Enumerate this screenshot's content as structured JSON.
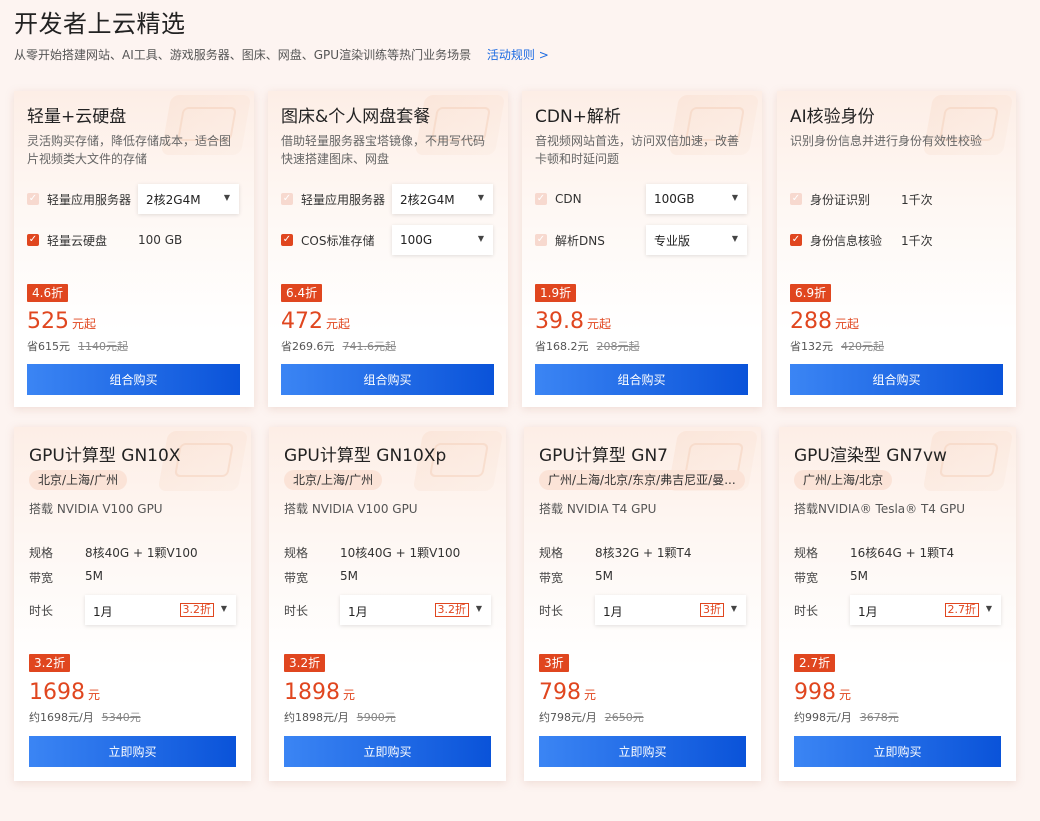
{
  "header": {
    "title": "开发者上云精选",
    "subtitle": "从零开始搭建网站、AI工具、游戏服务器、图床、网盘、GPU渲染训练等热门业务场景",
    "rule_link": "活动规则 >"
  },
  "bundles": [
    {
      "title": "轻量+云硬盘",
      "desc": "灵活购买存储，降低存储成本，适合图片视频类大文件的存储",
      "options": [
        {
          "label": "轻量应用服务器",
          "checked": false,
          "select": "2核2G4M"
        },
        {
          "label": "轻量云硬盘",
          "checked": true,
          "value": "100 GB"
        }
      ],
      "discount": "4.6折",
      "price": "525",
      "price_unit": "元起",
      "save": "省615元",
      "original": "1140元起",
      "buy_label": "组合购买"
    },
    {
      "title": "图床&个人网盘套餐",
      "desc": "借助轻量服务器宝塔镜像，不用写代码快速搭建图床、网盘",
      "options": [
        {
          "label": "轻量应用服务器",
          "checked": false,
          "select": "2核2G4M"
        },
        {
          "label": "COS标准存储",
          "checked": true,
          "select": "100G"
        }
      ],
      "discount": "6.4折",
      "price": "472",
      "price_unit": "元起",
      "save": "省269.6元",
      "original": "741.6元起",
      "buy_label": "组合购买"
    },
    {
      "title": "CDN+解析",
      "desc": "音视频网站首选，访问双倍加速，改善卡顿和时延问题",
      "options": [
        {
          "label": "CDN",
          "checked": false,
          "select": "100GB"
        },
        {
          "label": "解析DNS",
          "checked": false,
          "select": "专业版"
        }
      ],
      "discount": "1.9折",
      "price": "39.8",
      "price_unit": "元起",
      "save": "省168.2元",
      "original": "208元起",
      "buy_label": "组合购买"
    },
    {
      "title": "AI核验身份",
      "desc": "识别身份信息并进行身份有效性校验",
      "options": [
        {
          "label": "身份证识别",
          "checked": false,
          "value": "1千次"
        },
        {
          "label": "身份信息核验",
          "checked": true,
          "value": "1千次"
        }
      ],
      "discount": "6.9折",
      "price": "288",
      "price_unit": "元起",
      "save": "省132元",
      "original": "420元起",
      "buy_label": "组合购买"
    }
  ],
  "gpus": [
    {
      "title": "GPU计算型 GN10X",
      "region": "北京/上海/广州",
      "desc": "搭载 NVIDIA V100 GPU",
      "spec_label": "规格",
      "spec": "8核40G + 1颗V100",
      "bw_label": "带宽",
      "bw": "5M",
      "dur_label": "时长",
      "dur": "1月",
      "dur_badge": "3.2折",
      "discount": "3.2折",
      "price": "1698",
      "price_unit": "元",
      "monthly": "约1698元/月",
      "original": "5340元",
      "buy_label": "立即购买"
    },
    {
      "title": "GPU计算型 GN10Xp",
      "region": "北京/上海/广州",
      "desc": "搭载 NVIDIA V100 GPU",
      "spec_label": "规格",
      "spec": "10核40G + 1颗V100",
      "bw_label": "带宽",
      "bw": "5M",
      "dur_label": "时长",
      "dur": "1月",
      "dur_badge": "3.2折",
      "discount": "3.2折",
      "price": "1898",
      "price_unit": "元",
      "monthly": "约1898元/月",
      "original": "5900元",
      "buy_label": "立即购买"
    },
    {
      "title": "GPU计算型 GN7",
      "region": "广州/上海/北京/东京/弗吉尼亚/曼...",
      "desc": "搭载 NVIDIA T4 GPU",
      "spec_label": "规格",
      "spec": "8核32G + 1颗T4",
      "bw_label": "带宽",
      "bw": "5M",
      "dur_label": "时长",
      "dur": "1月",
      "dur_badge": "3折",
      "discount": "3折",
      "price": "798",
      "price_unit": "元",
      "monthly": "约798元/月",
      "original": "2650元",
      "buy_label": "立即购买"
    },
    {
      "title": "GPU渲染型 GN7vw",
      "region": "广州/上海/北京",
      "desc": "搭载NVIDIA® Tesla® T4 GPU",
      "spec_label": "规格",
      "spec": "16核64G + 1颗T4",
      "bw_label": "带宽",
      "bw": "5M",
      "dur_label": "时长",
      "dur": "1月",
      "dur_badge": "2.7折",
      "discount": "2.7折",
      "price": "998",
      "price_unit": "元",
      "monthly": "约998元/月",
      "original": "3678元",
      "buy_label": "立即购买"
    }
  ],
  "colors": {
    "accent": "#e0461f",
    "button_start": "#3b85f4",
    "button_end": "#0a53d9",
    "background": "#fdf4f1"
  },
  "icons": {
    "check": "checkmark-icon",
    "caret": "caret-down-icon"
  }
}
